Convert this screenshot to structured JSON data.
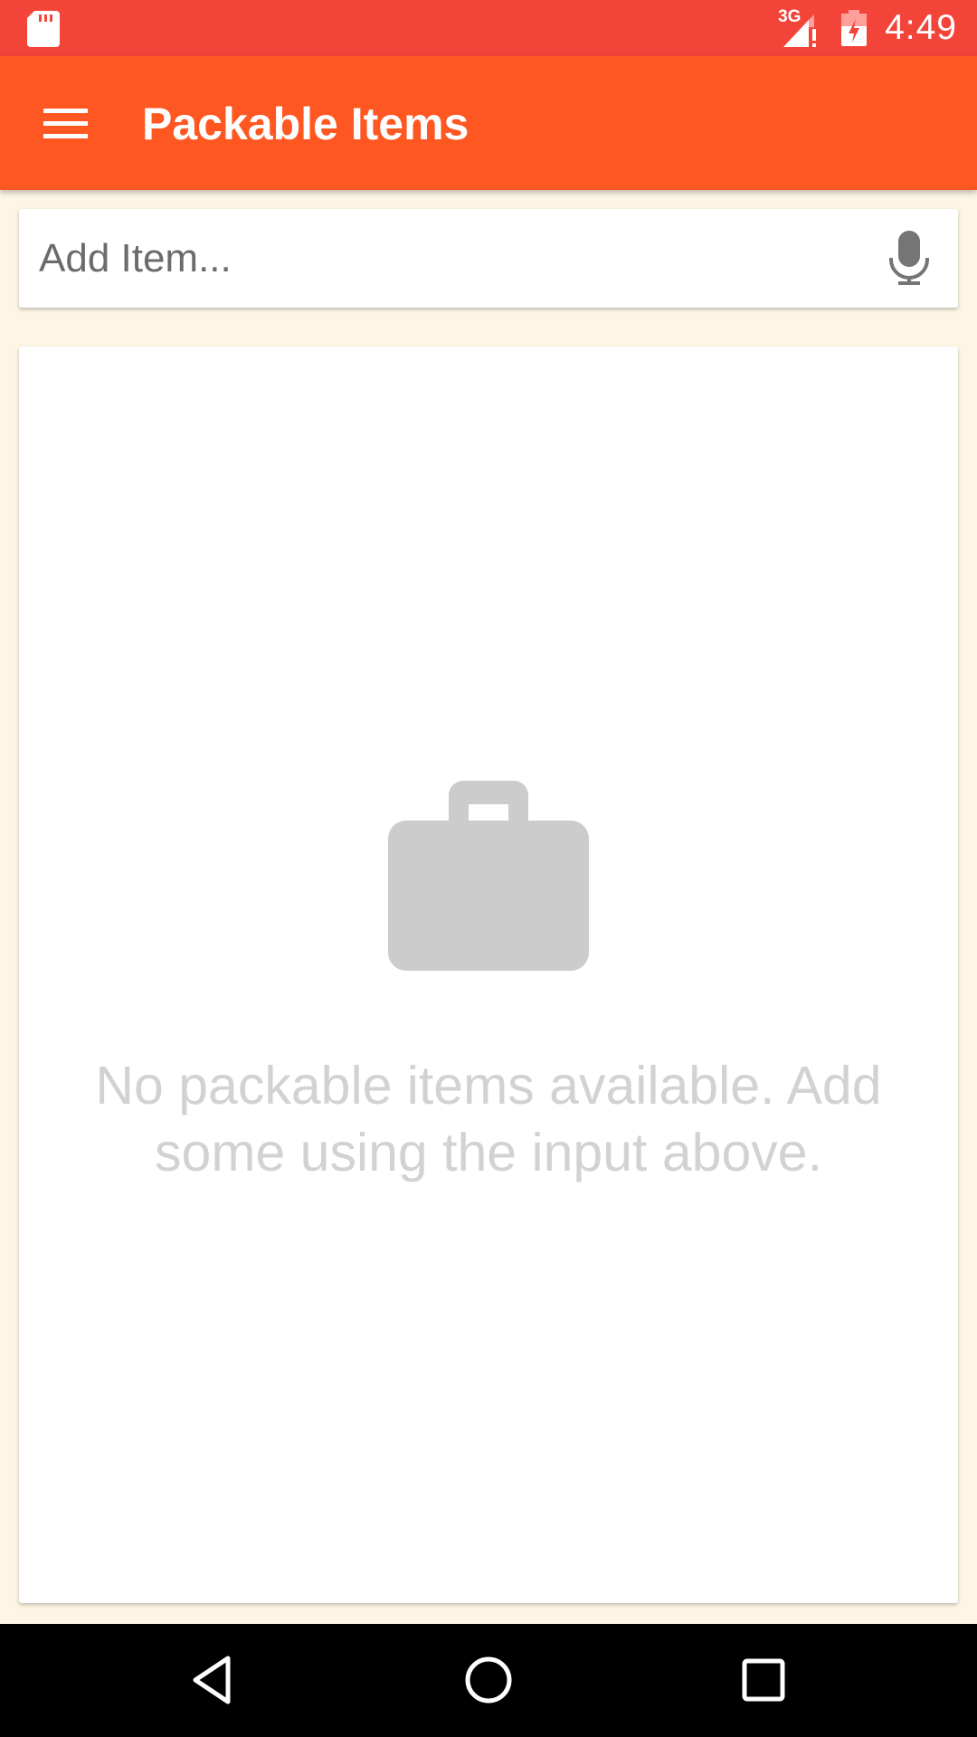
{
  "status_bar": {
    "time": "4:49",
    "network_label": "3G",
    "icons": [
      "sd-card-icon",
      "signal-icon",
      "battery-icon"
    ]
  },
  "app_bar": {
    "title": "Packable Items",
    "menu_icon": "menu-icon"
  },
  "add_item": {
    "placeholder": "Add Item...",
    "value": "",
    "voice_icon": "mic-icon"
  },
  "empty_state": {
    "icon": "briefcase-icon",
    "message": "No packable items available. Add some using the input above."
  },
  "nav_bar": {
    "icons": [
      "back-icon",
      "home-icon",
      "recents-icon"
    ]
  },
  "colors": {
    "status_bar": "#f3443a",
    "app_bar": "#ff5722",
    "background": "#fdf6e5",
    "empty_icon": "#cccccc",
    "empty_text": "#d2d2d2"
  }
}
